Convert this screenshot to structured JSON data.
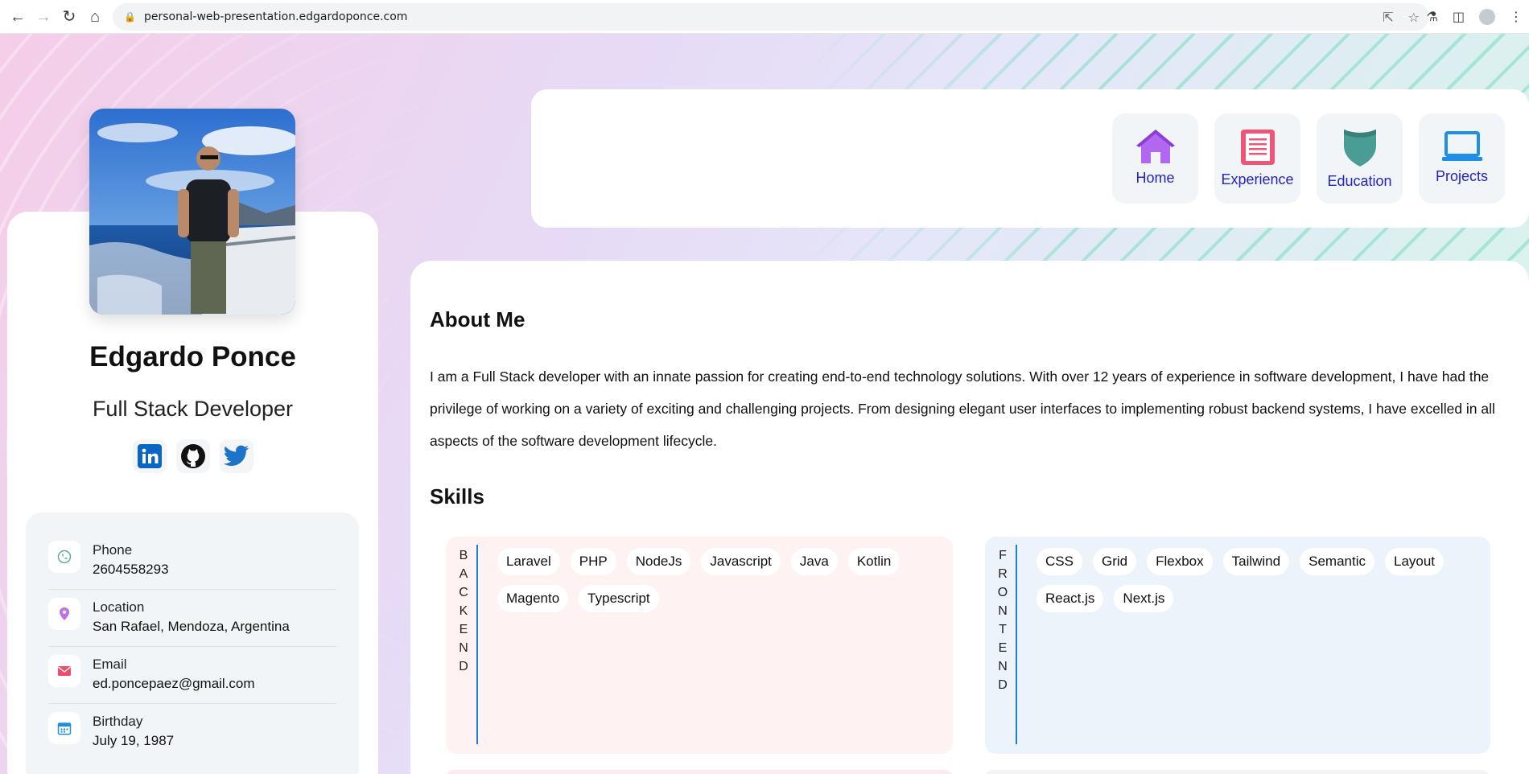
{
  "browser": {
    "url": "personal-web-presentation.edgardoponce.com"
  },
  "profile": {
    "name": "Edgardo Ponce",
    "role": "Full Stack Developer",
    "socials": [
      "linkedin-icon",
      "github-icon",
      "twitter-icon"
    ]
  },
  "contact": [
    {
      "label": "Phone",
      "value": "2604558293",
      "icon": "phone-icon",
      "color": "#5aa79a"
    },
    {
      "label": "Location",
      "value": "San Rafael, Mendoza, Argentina",
      "icon": "location-pin-icon",
      "color": "#c06de8"
    },
    {
      "label": "Email",
      "value": "ed.poncepaez@gmail.com",
      "icon": "envelope-icon",
      "color": "#ec4f6b"
    },
    {
      "label": "Birthday",
      "value": "July 19, 1987",
      "icon": "calendar-icon",
      "color": "#1f8fe0"
    }
  ],
  "nav": [
    {
      "label": "Home",
      "icon": "house-icon",
      "color": "#b267f0"
    },
    {
      "label": "Experience",
      "icon": "document-icon",
      "color": "#ef5577"
    },
    {
      "label": "Education",
      "icon": "shield-icon",
      "color": "#4a9d95"
    },
    {
      "label": "Projects",
      "icon": "laptop-icon",
      "color": "#1d8fe8"
    }
  ],
  "about": {
    "title": "About Me",
    "text": "I am a Full Stack developer with an innate passion for creating end-to-end technology solutions. With over 12 years of experience in software development, I have had the privilege of working on a variety of exciting and challenging projects. From designing elegant user interfaces to implementing robust backend systems, I have excelled in all aspects of the software development lifecycle."
  },
  "skills": {
    "title": "Skills",
    "backend": {
      "label": "BACKEND",
      "items": [
        "Laravel",
        "PHP",
        "NodeJs",
        "Javascript",
        "Java",
        "Kotlin",
        "Magento",
        "Typescript"
      ]
    },
    "frontend": {
      "label": "FRONTEND",
      "items": [
        "CSS",
        "Grid",
        "Flexbox",
        "Tailwind",
        "Semantic",
        "Layout",
        "React.js",
        "Next.js"
      ]
    }
  }
}
